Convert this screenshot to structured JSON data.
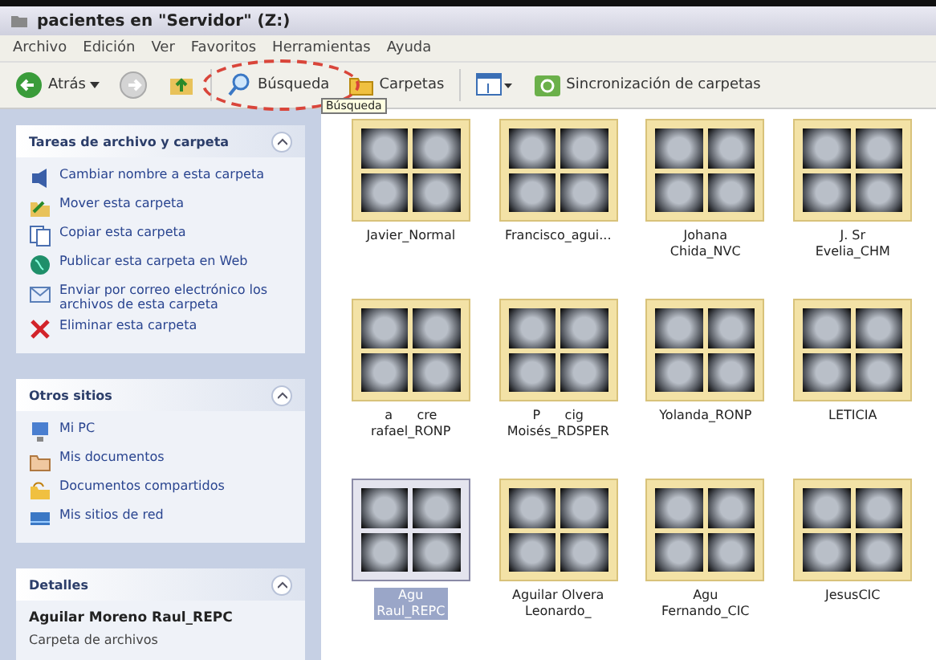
{
  "window": {
    "title": "pacientes en \"Servidor\" (Z:)"
  },
  "menu": [
    "Archivo",
    "Edición",
    "Ver",
    "Favoritos",
    "Herramientas",
    "Ayuda"
  ],
  "toolbar": [
    {
      "kind": "back",
      "label": "Atrás"
    },
    {
      "kind": "forward"
    },
    {
      "kind": "up"
    },
    {
      "kind": "search",
      "label": "Búsqueda",
      "highlighted": true,
      "tooltip": "Búsqueda"
    },
    {
      "kind": "folders",
      "label": "Carpetas"
    },
    {
      "kind": "views"
    },
    {
      "kind": "sync",
      "label": "Sincronización de carpetas"
    }
  ],
  "panels": [
    {
      "title": "Tareas de archivo y carpeta",
      "kind": "links",
      "items": [
        {
          "label": "Cambiar nombre a esta carpeta"
        },
        {
          "label": "Mover esta carpeta"
        },
        {
          "label": "Copiar esta carpeta"
        },
        {
          "label": "Publicar esta carpeta en Web"
        },
        {
          "label": "Enviar por correo electrónico los archivos de esta carpeta"
        },
        {
          "label": "Eliminar esta carpeta"
        }
      ]
    },
    {
      "title": "Otros sitios",
      "kind": "links",
      "items": [
        {
          "label": "Mi PC"
        },
        {
          "label": "Mis documentos"
        },
        {
          "label": "Documentos compartidos"
        },
        {
          "label": "Mis sitios de red"
        }
      ]
    },
    {
      "title": "Detalles",
      "kind": "details",
      "name": "Aguilar Moreno Raul_REPC",
      "type": "Carpeta de archivos"
    }
  ],
  "folders": [
    {
      "label": [
        "Javier_Normal"
      ],
      "selected": false
    },
    {
      "label": [
        "Francisco_agui..."
      ],
      "selected": false
    },
    {
      "label": [
        "Johana",
        "Chida_NVC"
      ],
      "selected": false
    },
    {
      "label": [
        "J. Sr",
        "Evelia_CHM"
      ],
      "selected": false
    },
    {
      "label": [
        "a      cre",
        "rafael_RONP"
      ],
      "selected": false
    },
    {
      "label": [
        "P      cig",
        "Moisés_RDSPER"
      ],
      "selected": false
    },
    {
      "label": [
        "Yolanda_RONP"
      ],
      "selected": false
    },
    {
      "label": [
        "LETICIA"
      ],
      "selected": false
    },
    {
      "label": [
        "Agu",
        "Raul_REPC"
      ],
      "selected": true
    },
    {
      "label": [
        "Aguilar Olvera",
        "Leonardo_"
      ],
      "selected": false
    },
    {
      "label": [
        "Agu",
        "Fernando_CIC"
      ],
      "selected": false
    },
    {
      "label": [
        "JesusCIC"
      ],
      "selected": false
    }
  ]
}
